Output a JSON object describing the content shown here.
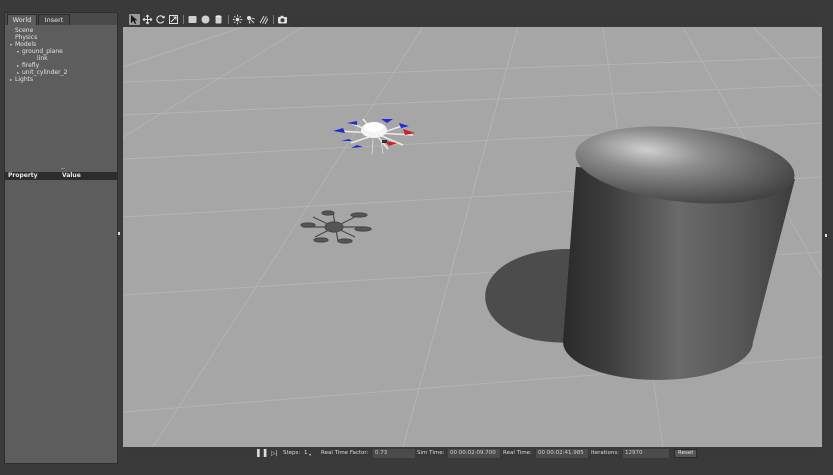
{
  "left_panel": {
    "tabs": [
      "World",
      "Insert"
    ],
    "tree": [
      {
        "label": "Scene",
        "arrow": ""
      },
      {
        "label": "Physics",
        "arrow": ""
      },
      {
        "label": "Models",
        "arrow": "▾"
      },
      {
        "label": "ground_plane",
        "arrow": "▾"
      },
      {
        "label": "link",
        "arrow": ""
      },
      {
        "label": "firefly",
        "arrow": "▸"
      },
      {
        "label": "unit_cylinder_2",
        "arrow": "▸"
      },
      {
        "label": "Lights",
        "arrow": "▸"
      }
    ],
    "property_header": {
      "property": "Property",
      "value": "Value"
    }
  },
  "toolbar": {
    "tools": [
      "select-arrow-icon",
      "translate-icon",
      "rotate-icon",
      "scale-icon",
      "box-icon",
      "sphere-icon",
      "cylinder-icon",
      "point-light-icon",
      "spot-light-icon",
      "directional-light-icon",
      "screenshot-icon"
    ],
    "selected_tool": "select-arrow-icon"
  },
  "bottom_bar": {
    "pause_icon": "pause-icon",
    "step_icon": "step-icon",
    "steps_label": "Steps:",
    "steps_value": "1",
    "real_time_factor_label": "Real Time Factor:",
    "real_time_factor": "0.73",
    "sim_time_label": "Sim Time:",
    "sim_time": "00 00:02:09.700",
    "real_time_label": "Real Time:",
    "real_time": "00 00:02:41.985",
    "iterations_label": "Iterations:",
    "iterations": "12970",
    "reset_label": "Reset"
  },
  "colors": {
    "ground": "#a6a6a6",
    "panel": "#5d5d5d",
    "toolbar": "#393939",
    "propeller_red": "#cc2020",
    "propeller_blue": "#1d2fcf"
  }
}
